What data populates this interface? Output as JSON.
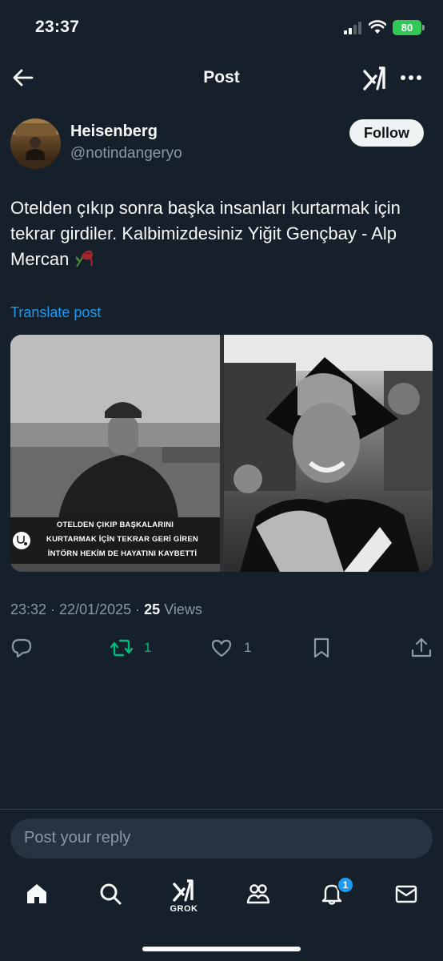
{
  "status_bar": {
    "time": "23:37",
    "battery": "80"
  },
  "header": {
    "title": "Post"
  },
  "author": {
    "display_name": "Heisenberg",
    "handle": "@notindangeryo",
    "follow_label": "Follow"
  },
  "post": {
    "text": "Otelden çıkıp sonra başka insanları kurtarmak için tekrar girdiler. Kalbimizdesiniz Yiğit Gençbay - Alp Mercan",
    "emoji": "wilted-rose",
    "translate_label": "Translate post"
  },
  "media": {
    "caption_lines": [
      "OTELDEN ÇIKIP BAŞKALARINI",
      "KURTARMAK İÇİN TEKRAR GERİ GİREN",
      "İNTÖRN HEKİM DE HAYATINI KAYBETTİ"
    ]
  },
  "meta": {
    "time": "23:32",
    "separator": " · ",
    "date": "22/01/2025",
    "views_count": "25",
    "views_label": "Views"
  },
  "actions": {
    "retweets": "1",
    "likes": "1"
  },
  "reply": {
    "placeholder": "Post your reply"
  },
  "nav": {
    "grok_label": "GROK",
    "notifications_badge": "1"
  },
  "colors": {
    "background": "#15202b",
    "accent": "#1d9bf0",
    "retweet_active": "#00ba7c",
    "muted": "#8b98a5"
  }
}
